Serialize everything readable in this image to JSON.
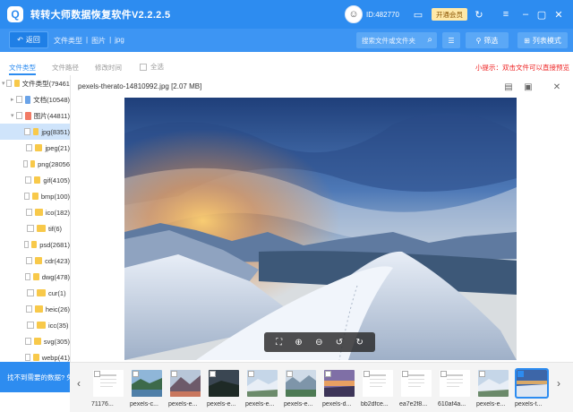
{
  "app": {
    "title": "转转大师数据恢复软件V2.2.2.5",
    "logo_glyph": "Q",
    "user_id": "ID:482770",
    "vip_label": "开通会员"
  },
  "navbar": {
    "back_label": "返回",
    "breadcrumb": [
      "文件类型",
      "|",
      "图片",
      "|",
      "jpg"
    ],
    "search_placeholder": "搜索文件或文件夹",
    "filter_label": "筛选",
    "list_mode_label": "列表模式"
  },
  "tabs": {
    "items": [
      "文件类型",
      "文件路径",
      "修改时间"
    ],
    "select_all": "全选",
    "tip": "小提示：双击文件可以直接预览"
  },
  "tree": [
    {
      "label": "文件类型(79461",
      "icon": "folder",
      "arrow": "▾",
      "indent": 0
    },
    {
      "label": "文档(10548)",
      "icon": "doc",
      "arrow": "▸",
      "indent": 1
    },
    {
      "label": "图片(44811)",
      "icon": "image",
      "arrow": "▾",
      "indent": 1
    },
    {
      "label": "jpg(8351)",
      "icon": "folder",
      "arrow": "",
      "indent": 2,
      "selected": true
    },
    {
      "label": "jpeg(21)",
      "icon": "folder",
      "arrow": "",
      "indent": 2
    },
    {
      "label": "png(28056",
      "icon": "folder",
      "arrow": "",
      "indent": 2
    },
    {
      "label": "gif(4105)",
      "icon": "folder",
      "arrow": "",
      "indent": 2
    },
    {
      "label": "bmp(100)",
      "icon": "folder",
      "arrow": "",
      "indent": 2
    },
    {
      "label": "ico(182)",
      "icon": "folder",
      "arrow": "",
      "indent": 2
    },
    {
      "label": "tif(6)",
      "icon": "folder",
      "arrow": "",
      "indent": 2
    },
    {
      "label": "psd(2681)",
      "icon": "folder",
      "arrow": "",
      "indent": 2
    },
    {
      "label": "cdr(423)",
      "icon": "folder",
      "arrow": "",
      "indent": 2
    },
    {
      "label": "dwg(478)",
      "icon": "folder",
      "arrow": "",
      "indent": 2
    },
    {
      "label": "cur(1)",
      "icon": "folder",
      "arrow": "",
      "indent": 2
    },
    {
      "label": "heic(26)",
      "icon": "folder",
      "arrow": "",
      "indent": 2
    },
    {
      "label": "icc(35)",
      "icon": "folder",
      "arrow": "",
      "indent": 2
    },
    {
      "label": "svg(305)",
      "icon": "folder",
      "arrow": "",
      "indent": 2
    },
    {
      "label": "webp(41)",
      "icon": "folder",
      "arrow": "",
      "indent": 2
    }
  ],
  "help": {
    "label": "找不到需要的数据? 免"
  },
  "preview": {
    "title": "pexels-therato-14810992.jpg [2.07 MB]"
  },
  "thumbnails": [
    {
      "caption": "71176...",
      "kind": "doc"
    },
    {
      "caption": "pexels-c...",
      "kind": "lake"
    },
    {
      "caption": "pexels-e...",
      "kind": "mountain"
    },
    {
      "caption": "pexels-e...",
      "kind": "dark"
    },
    {
      "caption": "pexels-e...",
      "kind": "snow"
    },
    {
      "caption": "pexels-e...",
      "kind": "valley"
    },
    {
      "caption": "pexels-d...",
      "kind": "sunset"
    },
    {
      "caption": "bb2dfce...",
      "kind": "doc"
    },
    {
      "caption": "ea7e2f8...",
      "kind": "doc"
    },
    {
      "caption": "610af4a...",
      "kind": "doc"
    },
    {
      "caption": "pexels-e...",
      "kind": "snow"
    },
    {
      "caption": "pexels-t...",
      "kind": "current",
      "selected": true
    }
  ]
}
